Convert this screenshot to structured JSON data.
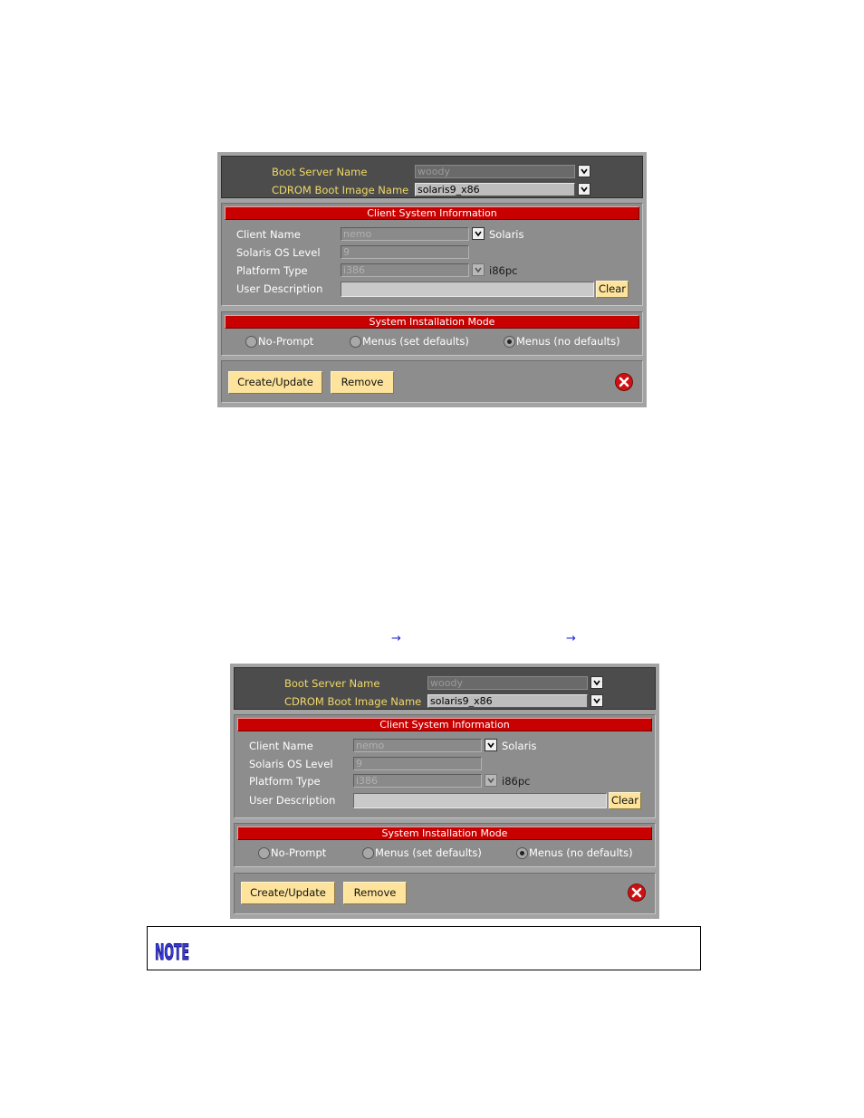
{
  "dialogs": [
    {
      "boot_server_label": "Boot Server Name",
      "boot_server_value": "woody",
      "cdrom_label": "CDROM Boot Image Name",
      "cdrom_value": "solaris9_x86",
      "client_section_title": "Client System Information",
      "client_name_label": "Client Name",
      "client_name_value": "nemo",
      "client_os": "Solaris",
      "os_level_label": "Solaris OS Level",
      "os_level_value": "9",
      "platform_label": "Platform Type",
      "platform_value": "i386",
      "platform_suffix": "i86pc",
      "user_desc_label": "User Description",
      "user_desc_value": "",
      "clear_label": "Clear",
      "mode_section_title": "System Installation Mode",
      "mode_options": [
        "No-Prompt",
        "Menus (set defaults)",
        "Menus (no defaults)"
      ],
      "mode_selected": "Menus (no defaults)",
      "create_label": "Create/Update",
      "remove_label": "Remove"
    },
    {
      "boot_server_label": "Boot Server Name",
      "boot_server_value": "woody",
      "cdrom_label": "CDROM Boot Image Name",
      "cdrom_value": "solaris9_x86",
      "client_section_title": "Client System Information",
      "client_name_label": "Client Name",
      "client_name_value": "nemo",
      "client_os": "Solaris",
      "os_level_label": "Solaris OS Level",
      "os_level_value": "9",
      "platform_label": "Platform Type",
      "platform_value": "i386",
      "platform_suffix": "i86pc",
      "user_desc_label": "User Description",
      "user_desc_value": "",
      "clear_label": "Clear",
      "mode_section_title": "System Installation Mode",
      "mode_options": [
        "No-Prompt",
        "Menus (set defaults)",
        "Menus (no defaults)"
      ],
      "mode_selected": "Menus (no defaults)",
      "create_label": "Create/Update",
      "remove_label": "Remove"
    }
  ],
  "arrows": [
    "→",
    "→"
  ],
  "note_icon_text": "NOTE",
  "colors": {
    "section_header": "#c80000",
    "boot_panel": "#4c4c4c",
    "label_yellow": "#f0d866",
    "button": "#fde39c",
    "close": "#d01010",
    "note_icon": "#3a3ae0"
  }
}
